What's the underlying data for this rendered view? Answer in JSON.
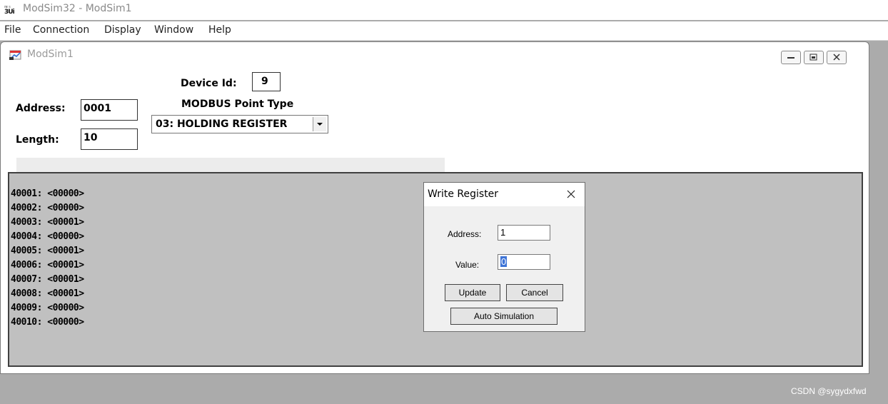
{
  "app": {
    "title": "ModSim32 - ModSim1",
    "icon": "modsim-app-icon"
  },
  "menu": {
    "items": [
      "File",
      "Connection",
      "Display",
      "Window",
      "Help"
    ]
  },
  "child_window": {
    "title": "ModSim1",
    "icon": "modsim-document-icon",
    "controls": [
      "minimize-icon",
      "restore-icon",
      "close-icon"
    ]
  },
  "form": {
    "device_id_label": "Device Id:",
    "device_id_value": "9",
    "point_type_label": "MODBUS Point Type",
    "point_type_value": "03: HOLDING REGISTER",
    "address_label": "Address:",
    "address_value": "0001",
    "length_label": "Length:",
    "length_value": "10"
  },
  "registers": [
    "40001: <00000>",
    "40002: <00000>",
    "40003: <00001>",
    "40004: <00000>",
    "40005: <00001>",
    "40006: <00001>",
    "40007: <00001>",
    "40008: <00001>",
    "40009: <00000>",
    "40010: <00000>"
  ],
  "dialog": {
    "title": "Write Register",
    "close_icon": "close-icon",
    "address_label": "Address:",
    "address_value": "1",
    "value_label": "Value:",
    "value_value": "0",
    "update_label": "Update",
    "cancel_label": "Cancel",
    "auto_sim_label": "Auto Simulation"
  },
  "watermark": "CSDN @sygydxfwd"
}
